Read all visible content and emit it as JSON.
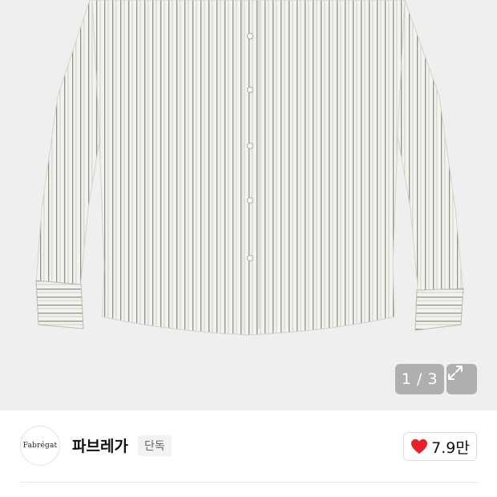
{
  "gallery": {
    "background_color": "#efefef",
    "page_indicator": "1 / 3",
    "expand_icon": "expand-icon"
  },
  "brand": {
    "logo_text": "Fabrégat",
    "name": "파브레가",
    "tag": "단독",
    "like_count": "7.9만",
    "heart_color": "#e8202a"
  }
}
